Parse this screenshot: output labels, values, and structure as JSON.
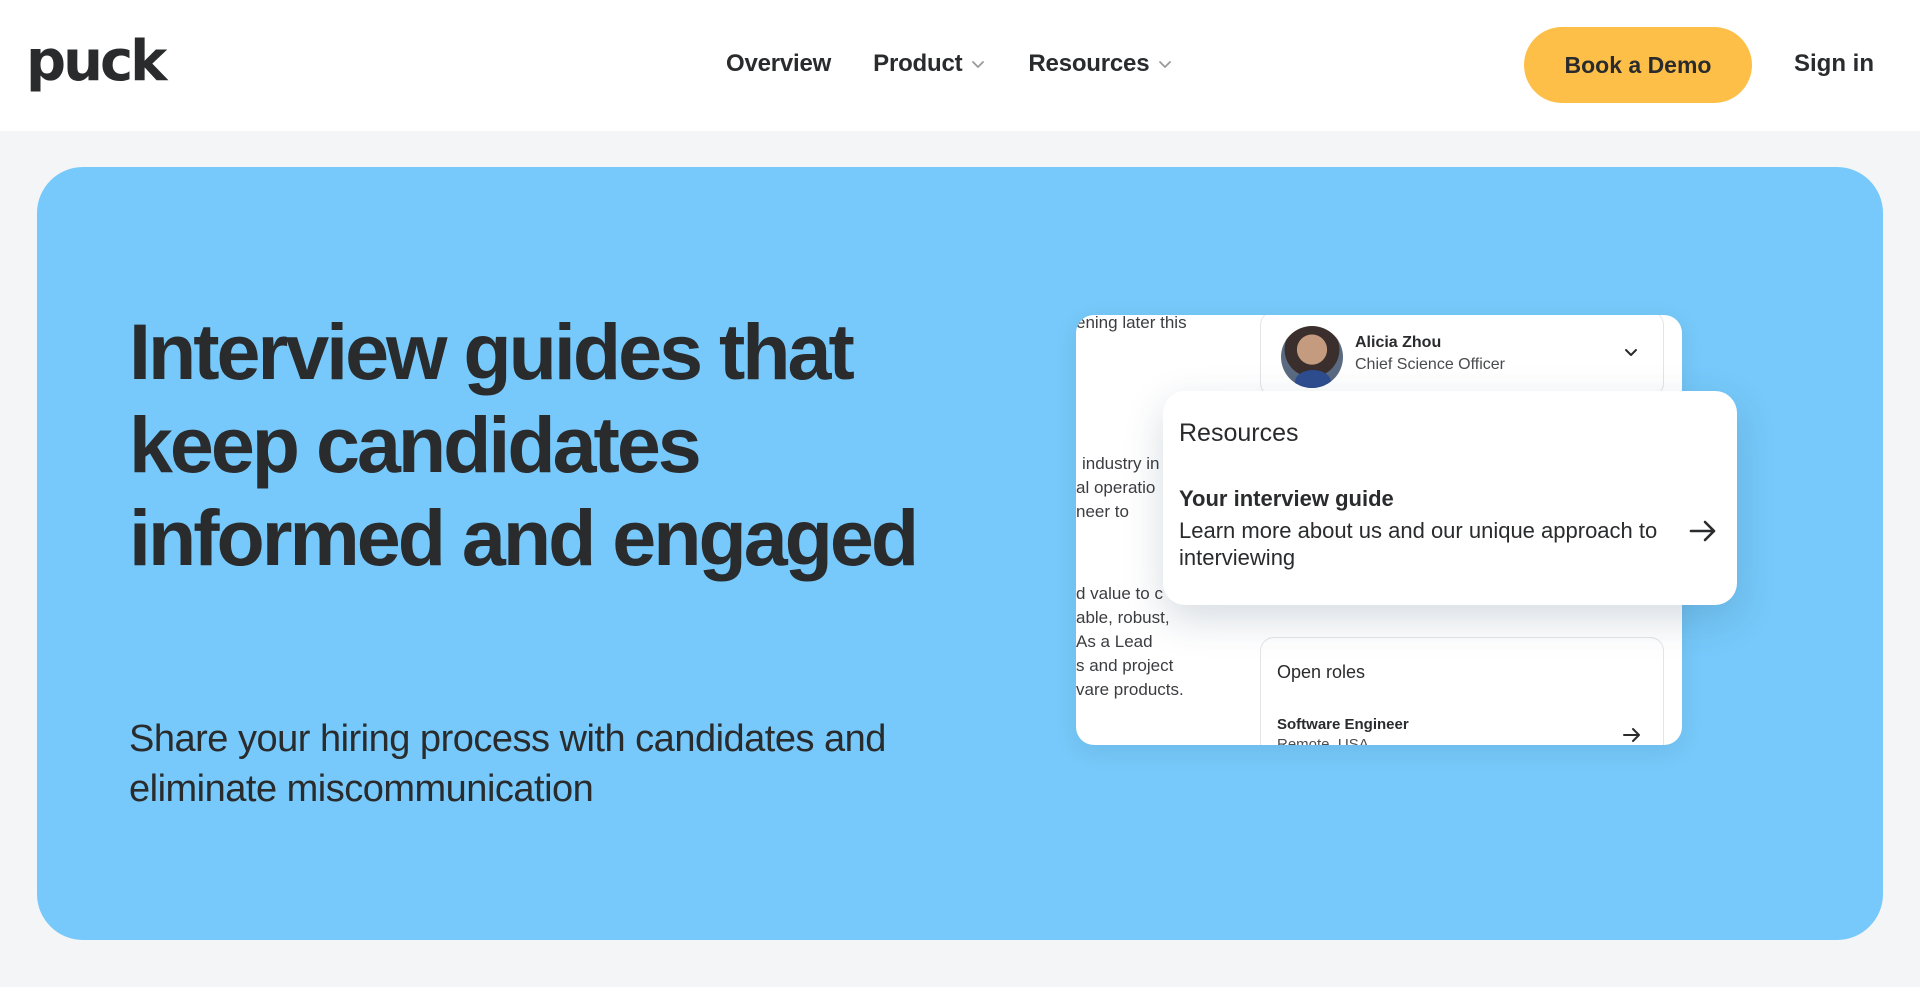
{
  "header": {
    "logo": "puck",
    "nav": [
      {
        "label": "Overview",
        "has_dropdown": false
      },
      {
        "label": "Product",
        "has_dropdown": true
      },
      {
        "label": "Resources",
        "has_dropdown": true
      }
    ],
    "cta_label": "Book a Demo",
    "signin_label": "Sign in"
  },
  "hero": {
    "title": "Interview guides that keep candidates informed and engaged",
    "subtitle": "Share your hiring process with candidates and eliminate miscommunication",
    "background_color": "#76c9fa"
  },
  "mock": {
    "text_fragments": [
      "ening later this",
      "industry in",
      "al operatio",
      "neer to",
      "d value to c",
      "able, robust,",
      "As a Lead",
      "s and project",
      "vare products."
    ],
    "profile": {
      "name": "Alicia Zhou",
      "role": "Chief Science Officer"
    },
    "open_roles": {
      "title": "Open roles",
      "role_name": "Software Engineer",
      "role_location": "Remote, USA"
    },
    "popover": {
      "title": "Resources",
      "item_title": "Your interview guide",
      "item_description": "Learn more about us and our unique approach to interviewing"
    }
  },
  "colors": {
    "accent": "#fdbf47",
    "text": "#2a2b2d",
    "page_background": "#f4f5f7"
  },
  "icons": [
    "chevron-down-icon",
    "arrow-right-icon",
    "avatar"
  ]
}
